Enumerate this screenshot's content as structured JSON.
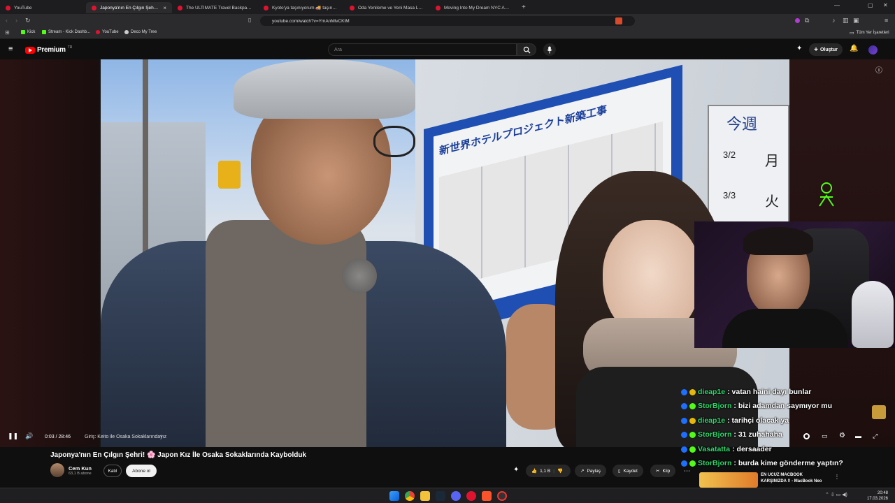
{
  "browser": {
    "tabs": [
      {
        "label": "YouTube",
        "active": false
      },
      {
        "label": "Japonya'nın En Çılgın Şehri! 🌸",
        "active": true
      },
      {
        "label": "The ULTIMATE Travel Backpack for P",
        "active": false
      },
      {
        "label": "Kyoto'ya taşınıyorum 🚚 taşınmaya",
        "active": false
      },
      {
        "label": "Oda Yenileme ve Yeni Masa Lambası",
        "active": false
      },
      {
        "label": "Moving Into My Dream NYC Apartm",
        "active": false
      }
    ],
    "url": "youtube.com/watch?v=YmAnMlvCKtM",
    "bookmarks": [
      "Kick",
      "Stream - Kick Dashb...",
      "YouTube",
      "Deco My Tree"
    ],
    "all_bookmarks": "Tüm Yer İşaretleri"
  },
  "yt": {
    "logo": "Premium",
    "logo_sup": "TR",
    "search_placeholder": "Ara",
    "create_label": "Oluştur"
  },
  "overlay": {
    "chat": [
      {
        "user": "dieap1e",
        "message": ": vatan haini dayı bunlar"
      },
      {
        "user": "StorBjorn",
        "message": ": bizi adamdan saymıyor mu"
      },
      {
        "user": "dieap1e",
        "message": ": tarihçi olacak ya"
      },
      {
        "user": "StorBjorn",
        "message": ": 31 zuhahaha"
      },
      {
        "user": "Vasatatta",
        "message": ": dersaader"
      },
      {
        "user": "StorBjorn",
        "message": ": burda kime gönderme yaptın?"
      }
    ],
    "video_sign": "新世界ホテルプロジェクト新築工事",
    "calendar_kanji": "今週",
    "calendar_cells": [
      "3/2",
      "月",
      "3/3",
      "火"
    ]
  },
  "player": {
    "time": "0:03 / 28:46",
    "chapter": "Giriş: Keito ile Osaka Sokaklarındayız",
    "progress": 0.002
  },
  "video": {
    "title": "Japonya'nın En Çılgın Şehri! 🌸 Japon Kız İle Osaka Sokaklarında Kaybolduk",
    "channel": "Cem Kun",
    "subs": "63,1 B abone",
    "join": "Katıl",
    "subscribe": "Abone ol",
    "likes": "1,1 B",
    "share": "Paylaş",
    "save": "Kaydet",
    "clip": "Klip"
  },
  "recommend": {
    "title1": "EN UCUZ MACBOOK",
    "title2": "KARŞINIZDA !! - MacBook Neo"
  },
  "taskbar": {
    "time": "20:48",
    "date": "17.03.2026"
  },
  "colors": {
    "accent": "#ff0000",
    "chat_user": "#2fd66b"
  }
}
